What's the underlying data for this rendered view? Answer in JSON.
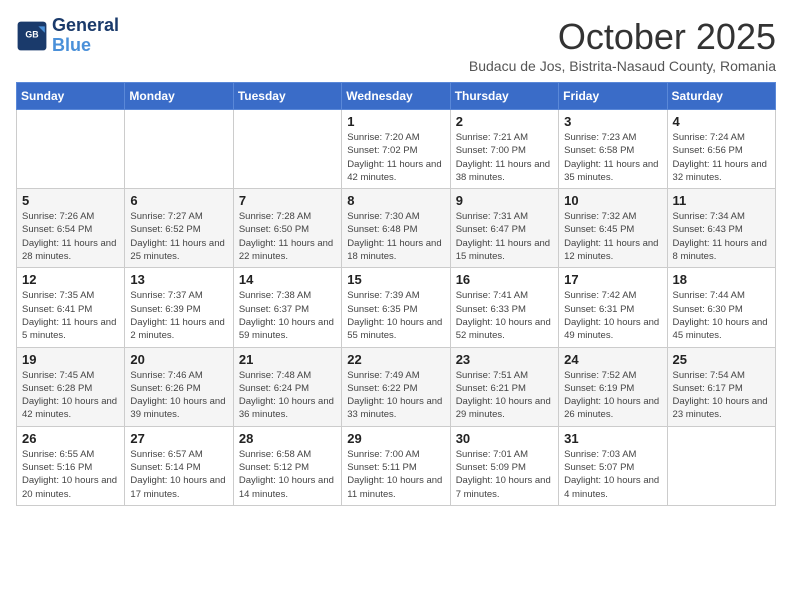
{
  "header": {
    "logo_line1": "General",
    "logo_line2": "Blue",
    "month": "October 2025",
    "location": "Budacu de Jos, Bistrita-Nasaud County, Romania"
  },
  "weekdays": [
    "Sunday",
    "Monday",
    "Tuesday",
    "Wednesday",
    "Thursday",
    "Friday",
    "Saturday"
  ],
  "weeks": [
    [
      {
        "day": "",
        "info": ""
      },
      {
        "day": "",
        "info": ""
      },
      {
        "day": "",
        "info": ""
      },
      {
        "day": "1",
        "info": "Sunrise: 7:20 AM\nSunset: 7:02 PM\nDaylight: 11 hours and 42 minutes."
      },
      {
        "day": "2",
        "info": "Sunrise: 7:21 AM\nSunset: 7:00 PM\nDaylight: 11 hours and 38 minutes."
      },
      {
        "day": "3",
        "info": "Sunrise: 7:23 AM\nSunset: 6:58 PM\nDaylight: 11 hours and 35 minutes."
      },
      {
        "day": "4",
        "info": "Sunrise: 7:24 AM\nSunset: 6:56 PM\nDaylight: 11 hours and 32 minutes."
      }
    ],
    [
      {
        "day": "5",
        "info": "Sunrise: 7:26 AM\nSunset: 6:54 PM\nDaylight: 11 hours and 28 minutes."
      },
      {
        "day": "6",
        "info": "Sunrise: 7:27 AM\nSunset: 6:52 PM\nDaylight: 11 hours and 25 minutes."
      },
      {
        "day": "7",
        "info": "Sunrise: 7:28 AM\nSunset: 6:50 PM\nDaylight: 11 hours and 22 minutes."
      },
      {
        "day": "8",
        "info": "Sunrise: 7:30 AM\nSunset: 6:48 PM\nDaylight: 11 hours and 18 minutes."
      },
      {
        "day": "9",
        "info": "Sunrise: 7:31 AM\nSunset: 6:47 PM\nDaylight: 11 hours and 15 minutes."
      },
      {
        "day": "10",
        "info": "Sunrise: 7:32 AM\nSunset: 6:45 PM\nDaylight: 11 hours and 12 minutes."
      },
      {
        "day": "11",
        "info": "Sunrise: 7:34 AM\nSunset: 6:43 PM\nDaylight: 11 hours and 8 minutes."
      }
    ],
    [
      {
        "day": "12",
        "info": "Sunrise: 7:35 AM\nSunset: 6:41 PM\nDaylight: 11 hours and 5 minutes."
      },
      {
        "day": "13",
        "info": "Sunrise: 7:37 AM\nSunset: 6:39 PM\nDaylight: 11 hours and 2 minutes."
      },
      {
        "day": "14",
        "info": "Sunrise: 7:38 AM\nSunset: 6:37 PM\nDaylight: 10 hours and 59 minutes."
      },
      {
        "day": "15",
        "info": "Sunrise: 7:39 AM\nSunset: 6:35 PM\nDaylight: 10 hours and 55 minutes."
      },
      {
        "day": "16",
        "info": "Sunrise: 7:41 AM\nSunset: 6:33 PM\nDaylight: 10 hours and 52 minutes."
      },
      {
        "day": "17",
        "info": "Sunrise: 7:42 AM\nSunset: 6:31 PM\nDaylight: 10 hours and 49 minutes."
      },
      {
        "day": "18",
        "info": "Sunrise: 7:44 AM\nSunset: 6:30 PM\nDaylight: 10 hours and 45 minutes."
      }
    ],
    [
      {
        "day": "19",
        "info": "Sunrise: 7:45 AM\nSunset: 6:28 PM\nDaylight: 10 hours and 42 minutes."
      },
      {
        "day": "20",
        "info": "Sunrise: 7:46 AM\nSunset: 6:26 PM\nDaylight: 10 hours and 39 minutes."
      },
      {
        "day": "21",
        "info": "Sunrise: 7:48 AM\nSunset: 6:24 PM\nDaylight: 10 hours and 36 minutes."
      },
      {
        "day": "22",
        "info": "Sunrise: 7:49 AM\nSunset: 6:22 PM\nDaylight: 10 hours and 33 minutes."
      },
      {
        "day": "23",
        "info": "Sunrise: 7:51 AM\nSunset: 6:21 PM\nDaylight: 10 hours and 29 minutes."
      },
      {
        "day": "24",
        "info": "Sunrise: 7:52 AM\nSunset: 6:19 PM\nDaylight: 10 hours and 26 minutes."
      },
      {
        "day": "25",
        "info": "Sunrise: 7:54 AM\nSunset: 6:17 PM\nDaylight: 10 hours and 23 minutes."
      }
    ],
    [
      {
        "day": "26",
        "info": "Sunrise: 6:55 AM\nSunset: 5:16 PM\nDaylight: 10 hours and 20 minutes."
      },
      {
        "day": "27",
        "info": "Sunrise: 6:57 AM\nSunset: 5:14 PM\nDaylight: 10 hours and 17 minutes."
      },
      {
        "day": "28",
        "info": "Sunrise: 6:58 AM\nSunset: 5:12 PM\nDaylight: 10 hours and 14 minutes."
      },
      {
        "day": "29",
        "info": "Sunrise: 7:00 AM\nSunset: 5:11 PM\nDaylight: 10 hours and 11 minutes."
      },
      {
        "day": "30",
        "info": "Sunrise: 7:01 AM\nSunset: 5:09 PM\nDaylight: 10 hours and 7 minutes."
      },
      {
        "day": "31",
        "info": "Sunrise: 7:03 AM\nSunset: 5:07 PM\nDaylight: 10 hours and 4 minutes."
      },
      {
        "day": "",
        "info": ""
      }
    ]
  ]
}
